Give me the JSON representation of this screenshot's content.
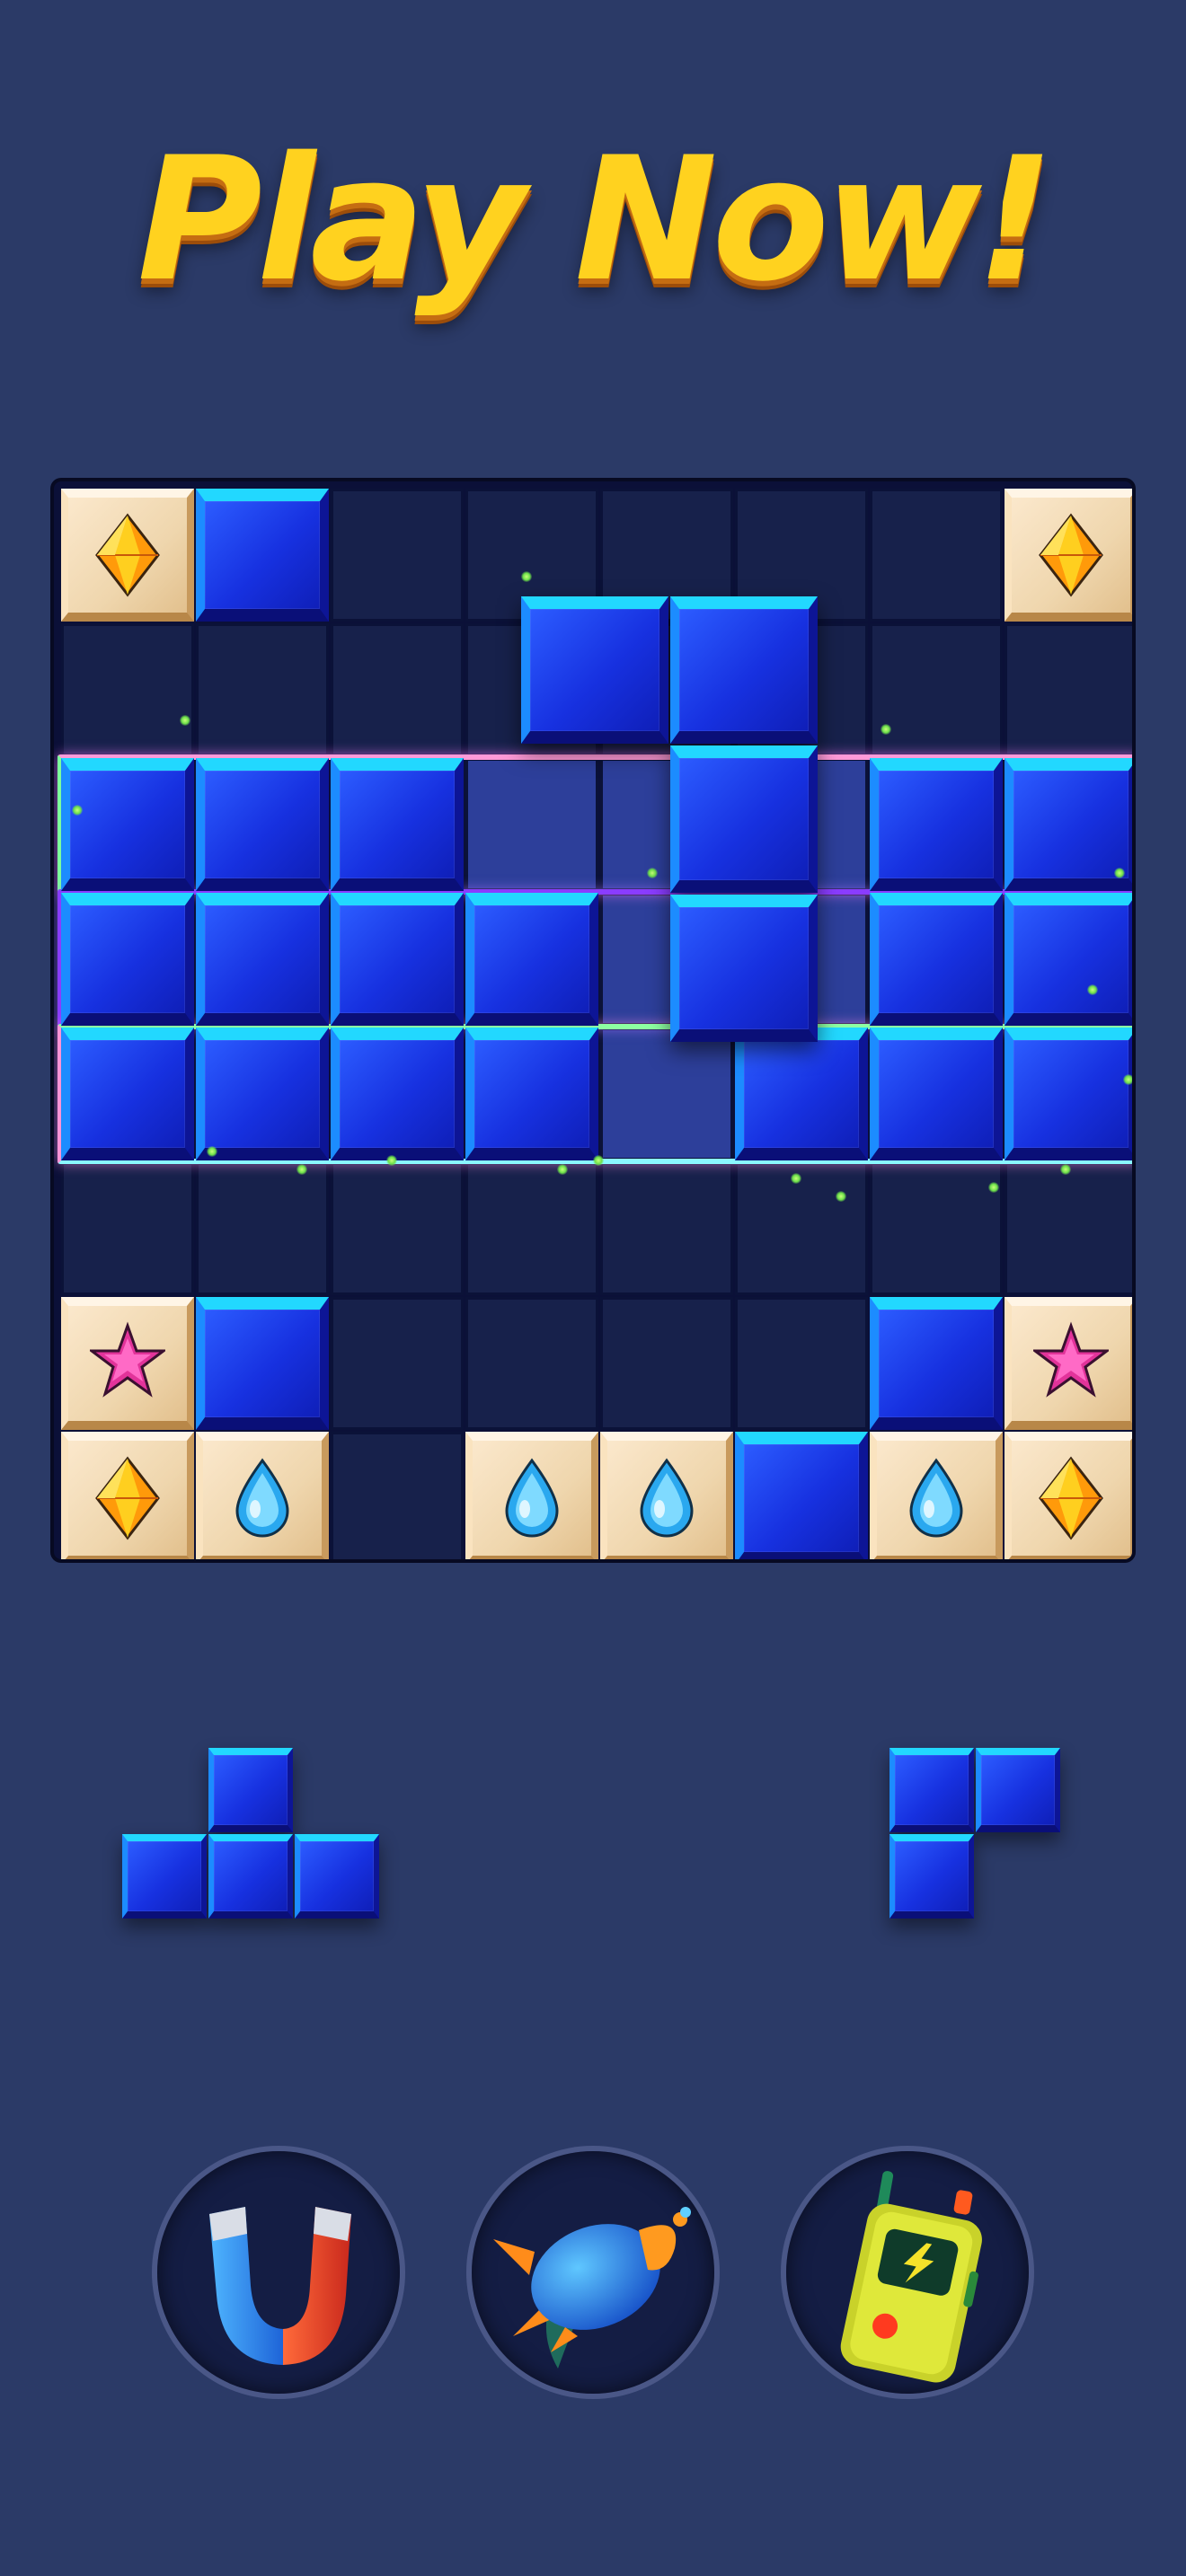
{
  "title": "Play Now!",
  "colors": {
    "background": "#2b3a67",
    "title_fill": "#ffd21f",
    "block_blue": "#1731e0",
    "block_highlight": "#22d8ff",
    "board_cell": "#17214b"
  },
  "board": {
    "columns": 8,
    "rows": 8,
    "gem_tiles": [
      {
        "row": 0,
        "col": 0,
        "gem": "diamond-icon"
      },
      {
        "row": 0,
        "col": 7,
        "gem": "diamond-icon"
      },
      {
        "row": 6,
        "col": 0,
        "gem": "star-icon"
      },
      {
        "row": 6,
        "col": 7,
        "gem": "star-icon"
      },
      {
        "row": 7,
        "col": 0,
        "gem": "diamond-icon"
      },
      {
        "row": 7,
        "col": 1,
        "gem": "water-drop-icon"
      },
      {
        "row": 7,
        "col": 3,
        "gem": "water-drop-icon"
      },
      {
        "row": 7,
        "col": 4,
        "gem": "water-drop-icon"
      },
      {
        "row": 7,
        "col": 6,
        "gem": "water-drop-icon"
      },
      {
        "row": 7,
        "col": 7,
        "gem": "diamond-icon"
      }
    ],
    "blue_blocks": [
      {
        "row": 0,
        "col": 1
      },
      {
        "row": 2,
        "col": 0
      },
      {
        "row": 2,
        "col": 1
      },
      {
        "row": 2,
        "col": 2
      },
      {
        "row": 2,
        "col": 6
      },
      {
        "row": 2,
        "col": 7
      },
      {
        "row": 3,
        "col": 0
      },
      {
        "row": 3,
        "col": 1
      },
      {
        "row": 3,
        "col": 2
      },
      {
        "row": 3,
        "col": 3
      },
      {
        "row": 3,
        "col": 6
      },
      {
        "row": 3,
        "col": 7
      },
      {
        "row": 4,
        "col": 0
      },
      {
        "row": 4,
        "col": 1
      },
      {
        "row": 4,
        "col": 2
      },
      {
        "row": 4,
        "col": 3
      },
      {
        "row": 4,
        "col": 5
      },
      {
        "row": 4,
        "col": 6
      },
      {
        "row": 4,
        "col": 7
      },
      {
        "row": 6,
        "col": 1
      },
      {
        "row": 6,
        "col": 6
      },
      {
        "row": 7,
        "col": 5
      }
    ],
    "highlighted_rows": [
      2,
      3,
      4
    ]
  },
  "dragged_piece": {
    "shape": "J",
    "cells": [
      [
        0,
        0
      ],
      [
        0,
        1
      ],
      [
        1,
        1
      ],
      [
        2,
        1
      ]
    ]
  },
  "tray": {
    "pieces": [
      {
        "name": "t-piece",
        "cells": [
          [
            0,
            1
          ],
          [
            1,
            0
          ],
          [
            1,
            1
          ],
          [
            1,
            2
          ]
        ]
      },
      {
        "name": "l-piece",
        "cells": [
          [
            0,
            0
          ],
          [
            0,
            1
          ],
          [
            1,
            0
          ]
        ]
      }
    ]
  },
  "powerups": [
    {
      "name": "magnet-powerup",
      "icon": "magnet-icon"
    },
    {
      "name": "rocket-powerup",
      "icon": "rocket-icon"
    },
    {
      "name": "walkie-talkie-powerup",
      "icon": "walkie-talkie-icon"
    }
  ]
}
